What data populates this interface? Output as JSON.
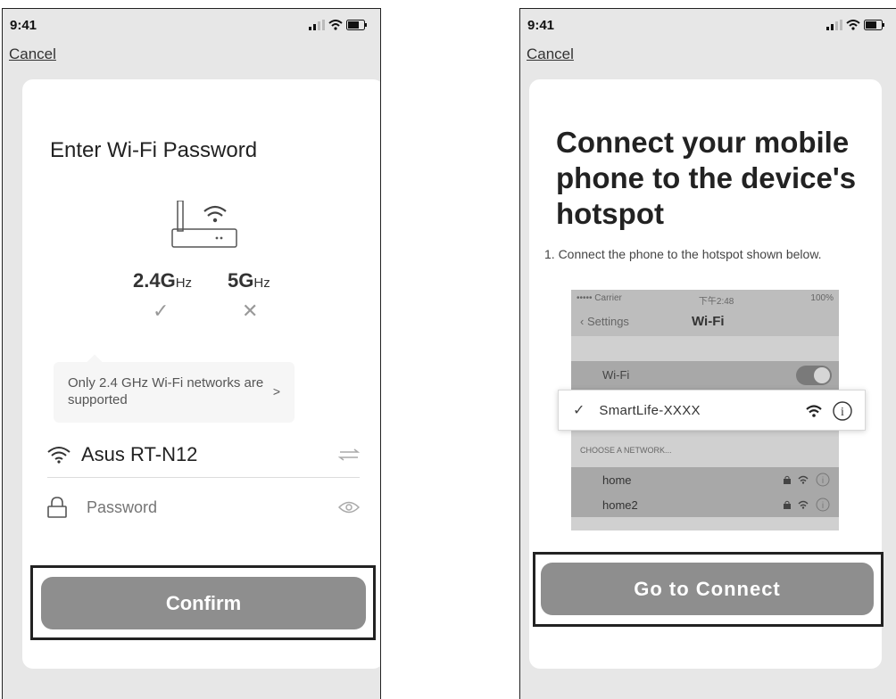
{
  "left_screen": {
    "status_time": "9:41",
    "cancel_label": "Cancel",
    "title": "Enter Wi-Fi Password",
    "band_24_main": "2.4G",
    "band_24_unit": "Hz",
    "band_24_mark": "✓",
    "band_5_main": "5G",
    "band_5_unit": "Hz",
    "band_5_mark": "✕",
    "tip_text": "Only 2.4 GHz Wi-Fi networks are supported",
    "tip_arrow": ">",
    "ssid": "Asus RT-N12",
    "password_placeholder": "Password",
    "confirm_label": "Confirm"
  },
  "right_screen": {
    "status_time": "9:41",
    "cancel_label": "Cancel",
    "title": "Connect your mobile phone to the device's hotspot",
    "step_text": "1. Connect the phone to the hotspot shown below.",
    "ios_settings": {
      "carrier": "••••• Carrier",
      "time": "下午2:48",
      "battery": "100%",
      "back_label": "Settings",
      "nav_title": "Wi-Fi",
      "wifi_label": "Wi-Fi",
      "selected_network": "SmartLife-XXXX",
      "choose_label": "CHOOSE A NETWORK...",
      "networks": [
        "home",
        "home2"
      ]
    },
    "go_connect_label": "Go to Connect"
  },
  "colors": {
    "button_gray": "#8e8e8e",
    "screen_bg": "#e7e7e7",
    "card_bg": "#ffffff",
    "highlight_border": "#222222"
  }
}
